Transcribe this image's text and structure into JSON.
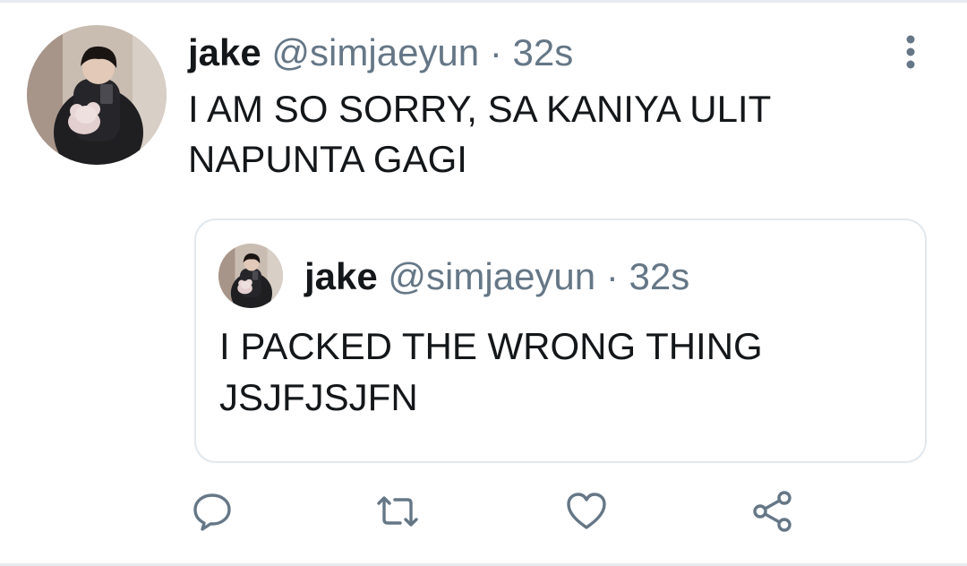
{
  "tweet": {
    "display_name": "jake",
    "handle": "@simjaeyun",
    "separator": "·",
    "time": "32s",
    "text": "I AM SO SORRY, SA KANIYA ULIT NAPUNTA GAGI"
  },
  "quoted_tweet": {
    "display_name": "jake",
    "handle": "@simjaeyun",
    "separator": "·",
    "time": "32s",
    "text": "I PACKED THE WRONG THING JSJFJSJFN"
  },
  "actions": [
    "reply-icon",
    "retweet-icon",
    "like-icon",
    "share-icon"
  ],
  "colors": {
    "text": "#14171a",
    "secondary": "#657786",
    "border": "#e1e8ed",
    "divider": "#e6ecf0"
  }
}
